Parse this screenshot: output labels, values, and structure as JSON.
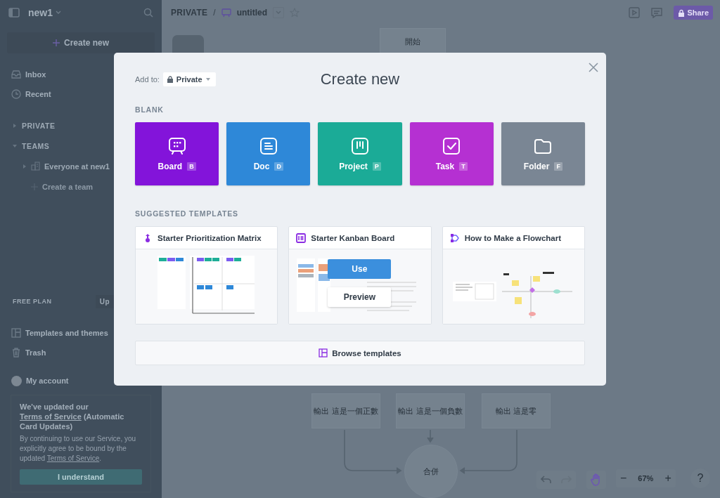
{
  "sidebar": {
    "workspace": "new1",
    "create_button": "Create new",
    "nav": [
      {
        "kind": "inbox",
        "label": "Inbox"
      },
      {
        "kind": "recent",
        "label": "Recent"
      }
    ],
    "sections": [
      {
        "label": "PRIVATE",
        "expanded": false
      },
      {
        "label": "TEAMS",
        "expanded": true,
        "children": [
          {
            "label": "Everyone at new1",
            "expanded": false
          }
        ]
      }
    ],
    "create_team": "Create a team",
    "plan": {
      "label": "FREE PLAN",
      "upgrade": "Up"
    },
    "bottom_nav": [
      {
        "kind": "templates",
        "label": "Templates and themes"
      },
      {
        "kind": "trash",
        "label": "Trash"
      }
    ],
    "account": "My account",
    "notice": {
      "title_before": "We've updated our ",
      "title_link": "Terms of Service",
      "title_after": " (Automatic Card Updates)",
      "body_before": "By continuing to use our Service, you explicitly agree to be bound by the updated ",
      "body_link": "Terms of Service",
      "body_after": ".",
      "button": "I understand"
    }
  },
  "topbar": {
    "breadcrumb": "PRIVATE",
    "separator": "/",
    "board_name": "untitled",
    "share": "Share"
  },
  "canvas": {
    "start_node": "開始",
    "output_nodes": [
      "輸出 這是一個正數",
      "輸出 這是一個負數",
      "輸出 這是零"
    ],
    "merge_node": "合併",
    "zoom_out": "−",
    "zoom": "67%",
    "zoom_in": "+",
    "help": "?"
  },
  "modal": {
    "add_to_label": "Add to:",
    "add_to_value": "Private",
    "title": "Create new",
    "blank_heading": "BLANK",
    "blank_items": [
      {
        "kind": "board",
        "label": "Board",
        "shortcut": "B",
        "color": "#8314da"
      },
      {
        "kind": "doc",
        "label": "Doc",
        "shortcut": "D",
        "color": "#2e88d8"
      },
      {
        "kind": "project",
        "label": "Project",
        "shortcut": "P",
        "color": "#1bab97"
      },
      {
        "kind": "task",
        "label": "Task",
        "shortcut": "T",
        "color": "#b530d2"
      },
      {
        "kind": "folder",
        "label": "Folder",
        "shortcut": "F",
        "color": "#7a8694"
      }
    ],
    "templates_heading": "SUGGESTED TEMPLATES",
    "templates": [
      {
        "kind": "matrix",
        "title": "Starter Prioritization Matrix"
      },
      {
        "kind": "kanban",
        "title": "Starter Kanban Board",
        "actions": [
          "Use",
          "Preview"
        ]
      },
      {
        "kind": "flowchart",
        "title": "How to Make a Flowchart"
      }
    ],
    "browse": "Browse templates"
  }
}
